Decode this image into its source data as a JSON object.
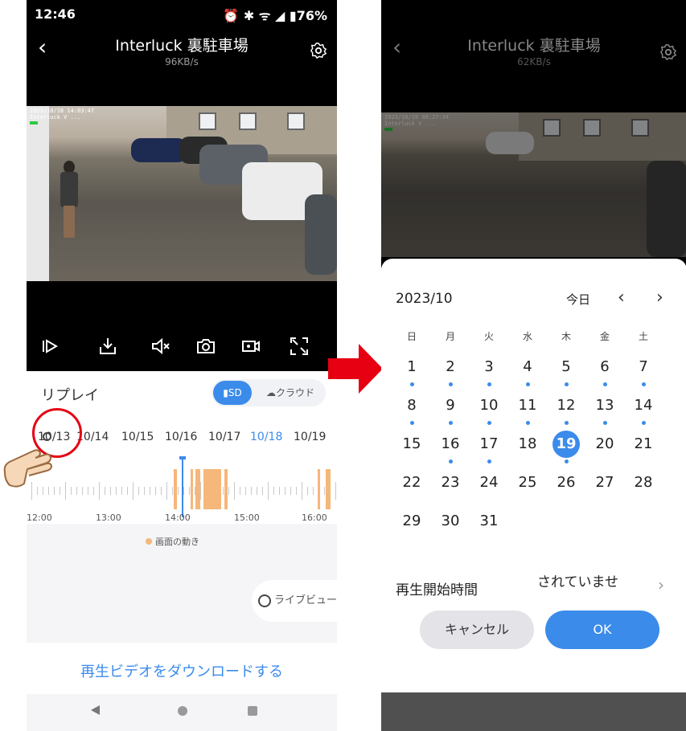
{
  "left": {
    "status": {
      "time": "12:46",
      "right": "⏰ ✱ ᯤ ◢ ▮76%"
    },
    "header": {
      "back": "‹",
      "title": "Interluck 裏駐車場",
      "rate": "96KB/s"
    },
    "video": {
      "osd_line1": "2023/10/18 14:03:47",
      "osd_line2": "Interluck  V  ..."
    },
    "controls": [
      "slow-play-icon",
      "download-icon",
      "mute-icon",
      "snapshot-icon",
      "record-icon",
      "fullscreen-icon"
    ],
    "replay": {
      "title": "リプレイ",
      "source_sd": "SD",
      "source_cloud": "クラウド",
      "dates": [
        "10/13",
        "10/14",
        "10/15",
        "10/16",
        "10/17",
        "10/18",
        "10/19"
      ],
      "active_date": "10/18",
      "times": [
        "12:00",
        "13:00",
        "14:00",
        "15:00",
        "16:00"
      ],
      "legend": "画面の動き",
      "live": "ライブビュー",
      "download": "再生ビデオをダウンロードする"
    },
    "colors": {
      "accent": "#3b8beb",
      "motion": "#f5b77a"
    }
  },
  "right": {
    "header": {
      "back": "‹",
      "title": "Interluck 裏駐車場",
      "rate": "62KB/s"
    },
    "video": {
      "osd_line1": "2023/10/19 08:27:34",
      "osd_line2": "Interluck  V  ..."
    },
    "calendar": {
      "month": "2023/10",
      "today": "今日",
      "prev": "‹",
      "next": "›",
      "weekdays": [
        "日",
        "月",
        "火",
        "水",
        "木",
        "金",
        "土"
      ],
      "days": [
        [
          "1",
          "2",
          "3",
          "4",
          "5",
          "6",
          "7"
        ],
        [
          "8",
          "9",
          "10",
          "11",
          "12",
          "13",
          "14"
        ],
        [
          "15",
          "16",
          "17",
          "18",
          "19",
          "20",
          "21"
        ],
        [
          "22",
          "23",
          "24",
          "25",
          "26",
          "27",
          "28"
        ],
        [
          "29",
          "30",
          "31"
        ]
      ],
      "selected": "19",
      "days_with_recordings": [
        "1",
        "2",
        "3",
        "4",
        "5",
        "6",
        "7",
        "8",
        "9",
        "10",
        "11",
        "12",
        "13",
        "14",
        "16",
        "17",
        "19"
      ]
    },
    "start_time": {
      "label": "再生開始時間",
      "value": "されていませ",
      "chevron": "›"
    },
    "buttons": {
      "cancel": "キャンセル",
      "ok": "OK"
    }
  }
}
